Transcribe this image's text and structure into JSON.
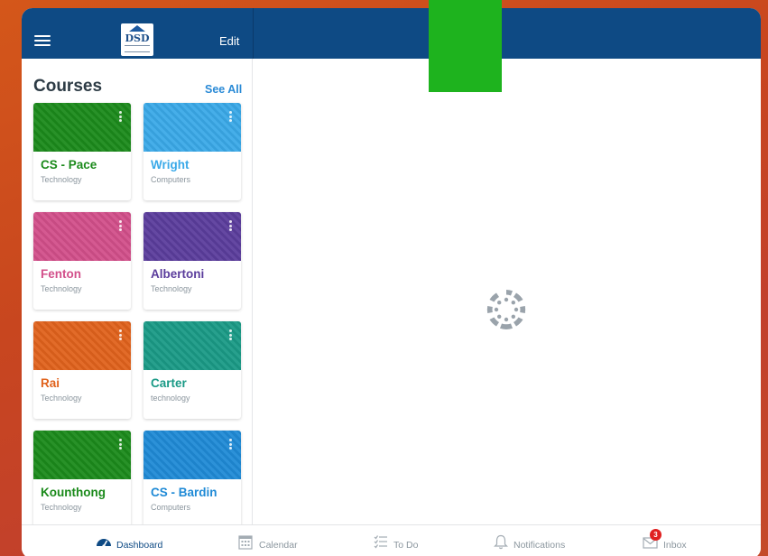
{
  "header": {
    "logo_text": "DSD",
    "edit_label": "Edit"
  },
  "courses": {
    "title": "Courses",
    "see_all_label": "See All",
    "items": [
      {
        "name": "CS - Pace",
        "subtitle": "Technology",
        "color": "#1b8a1b"
      },
      {
        "name": "Wright",
        "subtitle": "Computers",
        "color": "#3aa9e8"
      },
      {
        "name": "Fenton",
        "subtitle": "Technology",
        "color": "#d24f8a"
      },
      {
        "name": "Albertoni",
        "subtitle": "Technology",
        "color": "#5b3d9c"
      },
      {
        "name": "Rai",
        "subtitle": "Technology",
        "color": "#e0621c"
      },
      {
        "name": "Carter",
        "subtitle": "technology",
        "color": "#1a9a86"
      },
      {
        "name": "Kounthong",
        "subtitle": "Technology",
        "color": "#1b8a1b"
      },
      {
        "name": "CS - Bardin",
        "subtitle": "Computers",
        "color": "#1f8ad6"
      }
    ]
  },
  "tabs": {
    "dashboard": "Dashboard",
    "calendar": "Calendar",
    "todo": "To Do",
    "notifications": "Notifications",
    "inbox": "Inbox",
    "inbox_badge": "3"
  },
  "colors": {
    "header": "#0e4a84",
    "accent": "#2a8ad6",
    "overlay_block": "#1eb31e"
  },
  "icons": {
    "menu": "hamburger-icon",
    "loader": "canvas-logo-spinner-icon",
    "dashboard": "dashboard-gauge-icon",
    "calendar": "calendar-icon",
    "todo": "checklist-icon",
    "notifications": "bell-icon",
    "inbox": "envelope-icon"
  }
}
